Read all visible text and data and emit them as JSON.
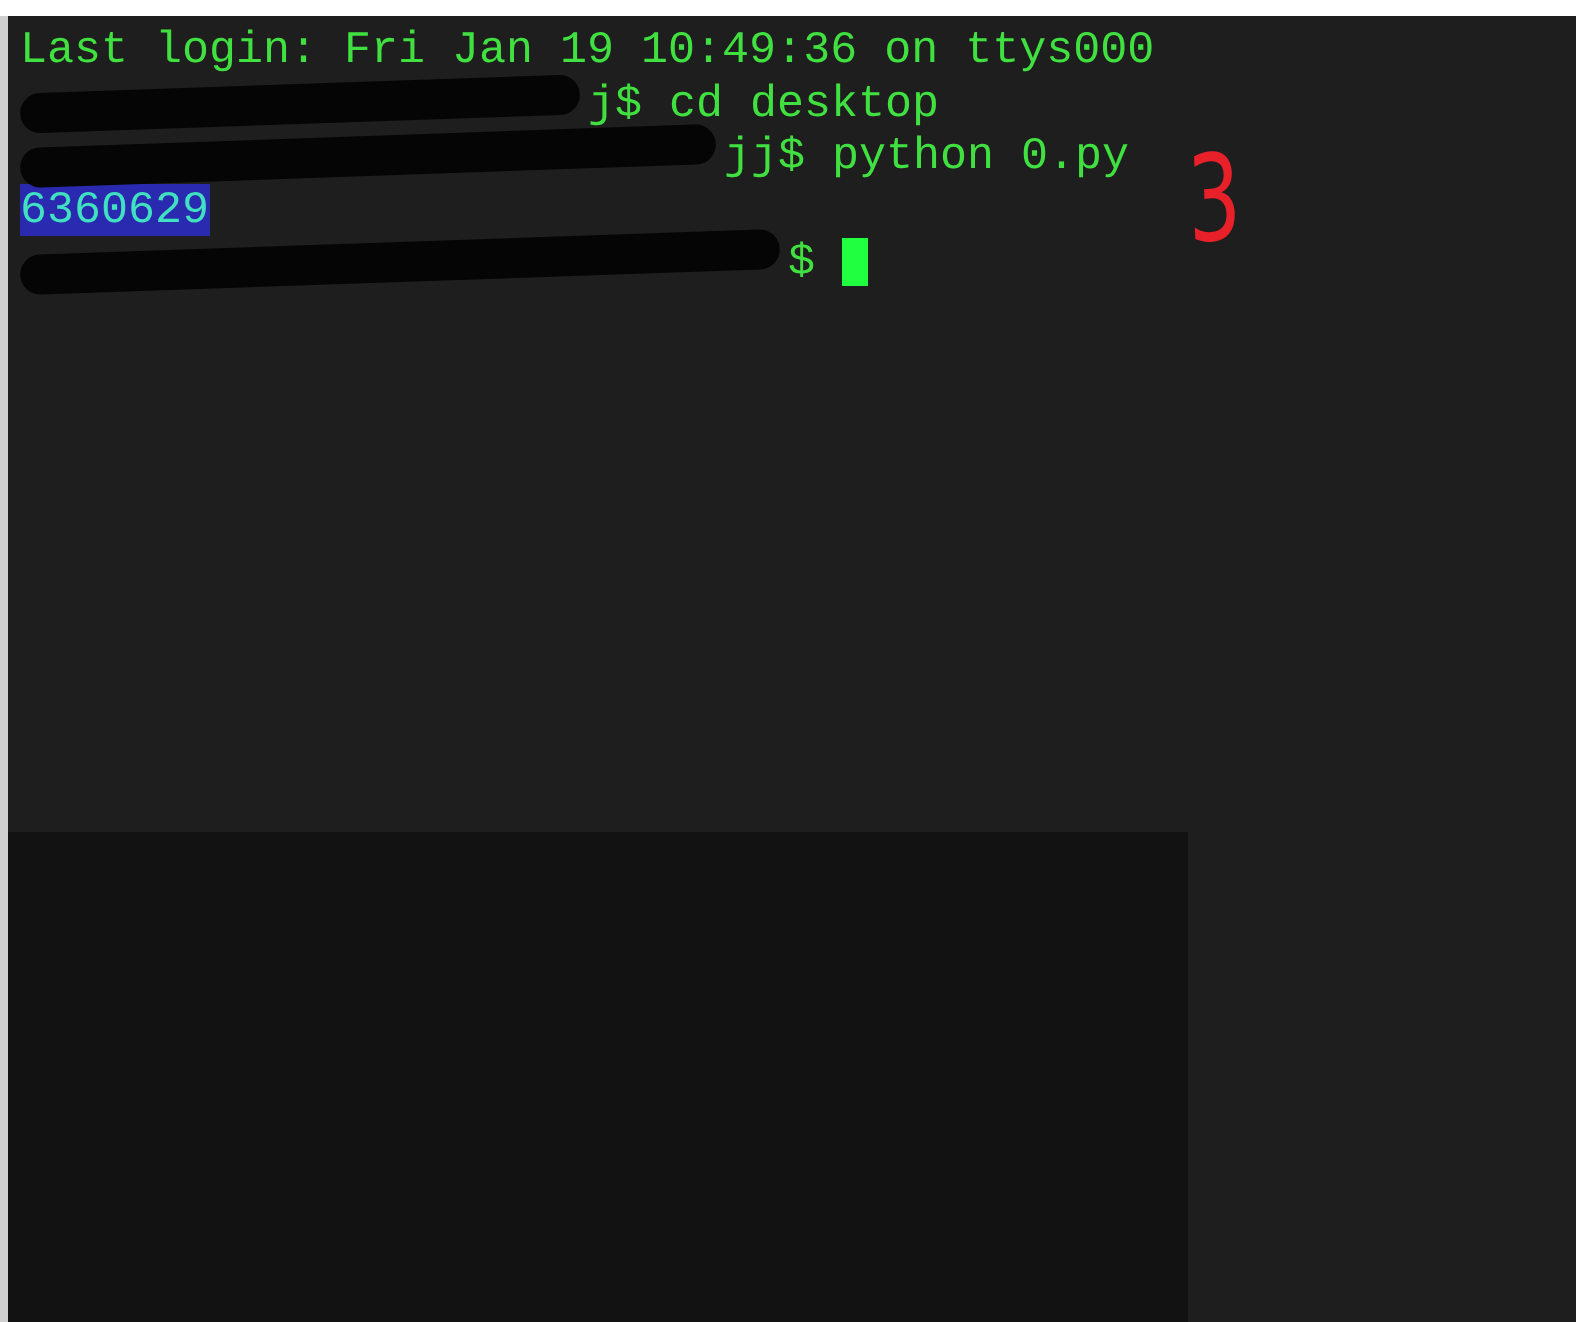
{
  "terminal": {
    "lines": [
      {
        "kind": "text",
        "text": "Last login: Fri Jan 19 10:49:36 on ttys000"
      },
      {
        "kind": "prompt",
        "text": "j$ cd desktop"
      },
      {
        "kind": "prompt",
        "text": "jj$ python 0.py"
      },
      {
        "kind": "output",
        "text": "6360629",
        "selected": true
      },
      {
        "kind": "prompt",
        "text": "$",
        "cursor": true
      }
    ]
  },
  "annotation": {
    "text": "3"
  }
}
